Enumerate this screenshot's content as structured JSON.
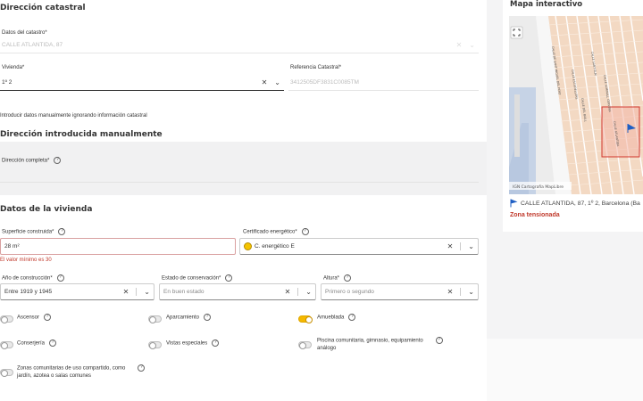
{
  "catastral": {
    "title": "Dirección catastral",
    "datos_label": "Datos del catastro*",
    "datos_value": "CALLE ATLANTIDA, 87",
    "vivienda_label": "Vivienda*",
    "vivienda_value": "1º 2",
    "referencia_label": "Referencia Catastral*",
    "referencia_value": "3412505DF3831C0085TM",
    "manual_link": "Introducir datos manualmente ignorando información catastral"
  },
  "manual": {
    "title": "Dirección introducida manualmente",
    "direccion_label": "Dirección completa*"
  },
  "vivienda": {
    "title": "Datos de la vivienda",
    "superficie_label": "Superficie construida*",
    "superficie_value": "28  m²",
    "superficie_error": "El valor mínimo es 30",
    "certificado_label": "Certificado energético*",
    "certificado_value": "C. energético E",
    "certificado_badge": "E",
    "anio_label": "Año de construcción*",
    "anio_value": "Entre 1919 y 1945",
    "estado_label": "Estado de conservación*",
    "estado_placeholder": "En buen estado",
    "altura_label": "Altura*",
    "altura_placeholder": "Primero o segundo",
    "toggles": {
      "ascensor": "Ascensor",
      "aparcamiento": "Aparcamiento",
      "amueblada": "Amueblada",
      "conserjeria": "Conserjería",
      "vistas": "Vistas especiales",
      "piscina_l1": "Piscina comunitaria, gimnasio, equipamiento",
      "piscina_l2": "análogo",
      "zonas_l1": "Zonas comunitarias de uso compartido, como",
      "zonas_l2": "jardín, azotea o salas comunes"
    },
    "toggle_state": {
      "amueblada": true
    }
  },
  "map": {
    "title": "Mapa interactivo",
    "address": "CALLE ATLANTIDA, 87, 1º 2, Barcelona (Ba",
    "zona": "Zona tensionada",
    "attribution": "IGN Cartografía MapLibre",
    "streets": [
      "CALLE DE SANT MIQUEL DEL PORT",
      "CALLE ESCUDELLERS",
      "CALLE SANT ELM",
      "CALLE DEL BAILL",
      "CALLE ALMIRALL CERVERA",
      "CALLE ATLANTIDA"
    ]
  },
  "colors": {
    "accent": "#f5b800",
    "error": "#c0392b",
    "zona": "#c0392b",
    "flag": "#1f5fc4"
  }
}
